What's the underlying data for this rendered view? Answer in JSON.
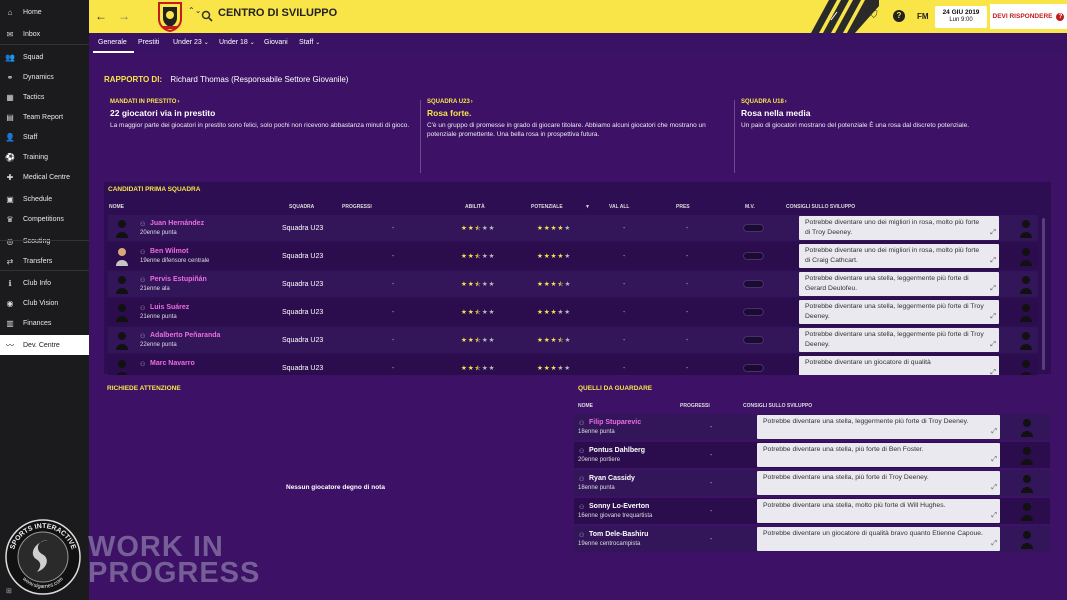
{
  "sidebar": {
    "items": [
      {
        "label": "Home",
        "icon": "home-icon",
        "glyph": "⌂"
      },
      {
        "label": "Inbox",
        "icon": "inbox-icon",
        "glyph": "✉"
      },
      {
        "label": "Squad",
        "icon": "squad-icon",
        "glyph": "👥"
      },
      {
        "label": "Dynamics",
        "icon": "dynamics-icon",
        "glyph": "⚭"
      },
      {
        "label": "Tactics",
        "icon": "tactics-icon",
        "glyph": "▦"
      },
      {
        "label": "Team Report",
        "icon": "team-report-icon",
        "glyph": "▤"
      },
      {
        "label": "Staff",
        "icon": "staff-icon",
        "glyph": "👤"
      },
      {
        "label": "Training",
        "icon": "training-icon",
        "glyph": "⚽"
      },
      {
        "label": "Medical Centre",
        "icon": "medical-icon",
        "glyph": "✚"
      },
      {
        "label": "Schedule",
        "icon": "schedule-icon",
        "glyph": "▣"
      },
      {
        "label": "Competitions",
        "icon": "competitions-icon",
        "glyph": "♛"
      },
      {
        "label": "Scouting",
        "icon": "scouting-icon",
        "glyph": "◎"
      },
      {
        "label": "Transfers",
        "icon": "transfers-icon",
        "glyph": "⇄"
      },
      {
        "label": "Club Info",
        "icon": "club-info-icon",
        "glyph": "ℹ"
      },
      {
        "label": "Club Vision",
        "icon": "club-vision-icon",
        "glyph": "◉"
      },
      {
        "label": "Finances",
        "icon": "finances-icon",
        "glyph": "▥"
      },
      {
        "label": "Dev. Centre",
        "icon": "dev-centre-icon",
        "glyph": "〰"
      }
    ],
    "active_index": 16
  },
  "topbar": {
    "title": "CENTRO DI SVILUPPO",
    "fm_label": "FM",
    "date": "24 GIU 2019",
    "time": "Lun 9:00",
    "respond_label": "DEVI RISPONDERE",
    "accent": "#f9e547"
  },
  "subnav": {
    "tabs": [
      "Generale",
      "Prestiti",
      "Under 23",
      "Under 18",
      "Giovani",
      "Staff"
    ]
  },
  "report": {
    "label": "RAPPORTO DI:",
    "author": "Richard Thomas (Responsabile Settore Giovanile)"
  },
  "summaries": [
    {
      "category": "MANDATI IN PRESTITO",
      "headline": "22 giocatori via in prestito",
      "description": "La maggior parte dei giocatori in prestito sono felici, solo pochi non ricevono abbastanza minuti di gioco."
    },
    {
      "category": "SQUADRA U23",
      "headline": "Rosa forte.",
      "description": "C'è un gruppo di promesse in grado di giocare titolare. Abbiamo alcuni giocatori che mostrano un potenziale promettente. Una bella rosa in prospettiva futura."
    },
    {
      "category": "SQUADRA U18",
      "headline": "Rosa nella media",
      "description": "Un paio di giocatori mostrano del potenziale È una rosa dal discreto potenziale."
    }
  ],
  "candidates": {
    "title": "CANDIDATI PRIMA SQUADRA",
    "columns": [
      "NOME",
      "SQUADRA",
      "PROGRESSI",
      "ABILITÀ",
      "POTENZIALE",
      "VAL ALL",
      "PRES",
      "M.V.",
      "CONSIGLI SULLO SVILUPPO"
    ],
    "sort_arrow": "▼",
    "rows": [
      {
        "name": "Juan Hernández",
        "desc": "20enne punta",
        "team": "Squadra U23",
        "progress": "-",
        "ability": 2.5,
        "potential": 4,
        "val": "-",
        "pres": "-",
        "advice": "Potrebbe diventare uno dei migliori in rosa, molto più forte di Troy Deeney."
      },
      {
        "name": "Ben Wilmot",
        "desc": "19enne difensore centrale",
        "team": "Squadra U23",
        "progress": "-",
        "ability": 2.5,
        "potential": 4,
        "val": "-",
        "pres": "-",
        "advice": "Potrebbe diventare uno dei migliori in rosa, molto più forte di Craig Cathcart."
      },
      {
        "name": "Pervis Estupiñán",
        "desc": "21enne ala",
        "team": "Squadra U23",
        "progress": "-",
        "ability": 2.5,
        "potential": 3.5,
        "val": "-",
        "pres": "-",
        "advice": "Potrebbe diventare una stella, leggermente più forte di Gerard Deulofeu."
      },
      {
        "name": "Luis Suárez",
        "desc": "21enne punta",
        "team": "Squadra U23",
        "progress": "-",
        "ability": 2.5,
        "potential": 3,
        "val": "-",
        "pres": "-",
        "advice": "Potrebbe diventare una stella, leggermente più forte di Troy Deeney."
      },
      {
        "name": "Adalberto Peñaranda",
        "desc": "22enne punta",
        "team": "Squadra U23",
        "progress": "-",
        "ability": 2.5,
        "potential": 3.5,
        "val": "-",
        "pres": "-",
        "advice": "Potrebbe diventare una stella, leggermente più forte di Troy Deeney."
      },
      {
        "name": "Marc Navarro",
        "desc": "",
        "team": "Squadra U23",
        "progress": "-",
        "ability": 2.5,
        "potential": 3,
        "val": "-",
        "pres": "-",
        "advice": "Potrebbe diventare un giocatore di qualità"
      }
    ]
  },
  "attention": {
    "title": "RICHIEDE ATTENZIONE",
    "empty_message": "Nessun giocatore degno di nota"
  },
  "watch": {
    "title": "QUELLI DA GUARDARE",
    "columns": [
      "NOME",
      "PROGRESSI",
      "CONSIGLI SULLO SVILUPPO"
    ],
    "rows": [
      {
        "name": "Filip Stuparevic",
        "desc": "18enne punta",
        "progress": "-",
        "advice": "Potrebbe diventare una stella, leggermente più forte di Troy Deeney."
      },
      {
        "name": "Pontus Dahlberg",
        "desc": "20enne portiere",
        "progress": "-",
        "advice": "Potrebbe diventare una stella, più forte di Ben Foster."
      },
      {
        "name": "Ryan Cassidy",
        "desc": "18enne punta",
        "progress": "-",
        "advice": "Potrebbe diventare una stella, più forte di Troy Deeney."
      },
      {
        "name": "Sonny Lo-Everton",
        "desc": "16enne giovane trequartista",
        "progress": "-",
        "advice": "Potrebbe diventare una stella, molto più forte di Will Hughes."
      },
      {
        "name": "Tom Dele-Bashiru",
        "desc": "19enne centrocampista",
        "progress": "-",
        "advice": "Potrebbe diventare un giocatore di qualità bravo quanto Etienne Capoue."
      }
    ]
  },
  "logo": {
    "ring_text": "SPORTS INTERACTIVE",
    "url": "www.sigames.com"
  },
  "watermark": {
    "line1": "WORK IN",
    "line2": "PROGRESS"
  }
}
